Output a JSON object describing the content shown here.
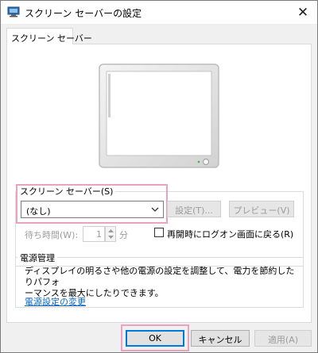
{
  "window": {
    "title": "スクリーン セーバーの設定",
    "close_glyph": "✕"
  },
  "tab": {
    "label": "スクリーン セーバー"
  },
  "screensaver": {
    "group_label": "スクリーン セーバー(S)",
    "selected": "(なし)",
    "settings_button": "設定(T)...",
    "preview_button": "プレビュー(V)"
  },
  "wait": {
    "label": "待ち時間(W):",
    "value": "1",
    "unit": "分",
    "checkbox_label": "再開時にログオン画面に戻る(R)",
    "checked": false
  },
  "power": {
    "group_label": "電源管理",
    "description": "ディスプレイの明るさや他の電源の設定を調整して、電力を節約したりパフォ\nーマンスを最大にしたりできます。",
    "link": "電源設定の変更"
  },
  "footer": {
    "ok": "OK",
    "cancel": "キャンセル",
    "apply": "適用(A)"
  },
  "icons": {
    "app": "screen-saver-settings-icon",
    "close": "close-icon",
    "combo_arrow": "chevron-down-icon",
    "spin_up": "spin-up-icon",
    "spin_down": "spin-down-icon"
  },
  "colors": {
    "highlight": "#e8a3c0",
    "link": "#0a64c8",
    "ok_border": "#0078d7"
  }
}
